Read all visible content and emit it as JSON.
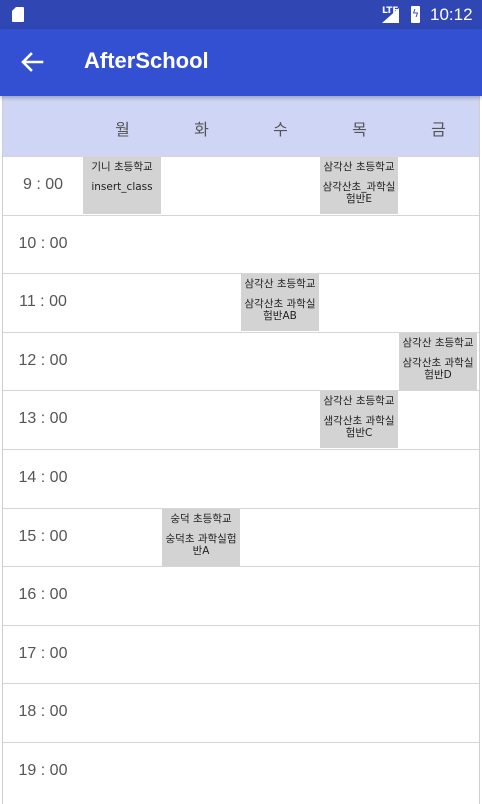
{
  "status_bar": {
    "network": "LTE",
    "time": "10:12"
  },
  "app_bar": {
    "title": "AfterSchool"
  },
  "days": [
    "월",
    "화",
    "수",
    "목",
    "금"
  ],
  "times": [
    "9 : 00",
    "10 : 00",
    "11 : 00",
    "12 : 00",
    "13 : 00",
    "14 : 00",
    "15 : 00",
    "16 : 00",
    "17 : 00",
    "18 : 00",
    "19 : 00"
  ],
  "classes": [
    {
      "school": "기니 초등학교",
      "class_name": "insert_class",
      "day": "월",
      "time": "9 : 00"
    },
    {
      "school": "삼각산 초등학교",
      "class_name": "삼각산초_과학실험반E",
      "day": "목",
      "time": "9 : 00"
    },
    {
      "school": "삼각산 초등학교",
      "class_name": "삼각산초 과학실험반AB",
      "day": "수",
      "time": "11 : 00"
    },
    {
      "school": "삼각산 초등학교",
      "class_name": "삼각산초 과학실험반D",
      "day": "금",
      "time": "12 : 00"
    },
    {
      "school": "삼각산 초등학교",
      "class_name": "샘각산초 과학실험반C",
      "day": "목",
      "time": "13 : 00"
    },
    {
      "school": "숭덕 초등학교",
      "class_name": "숭덕초 과학실험반A",
      "day": "화",
      "time": "15 : 00"
    }
  ]
}
